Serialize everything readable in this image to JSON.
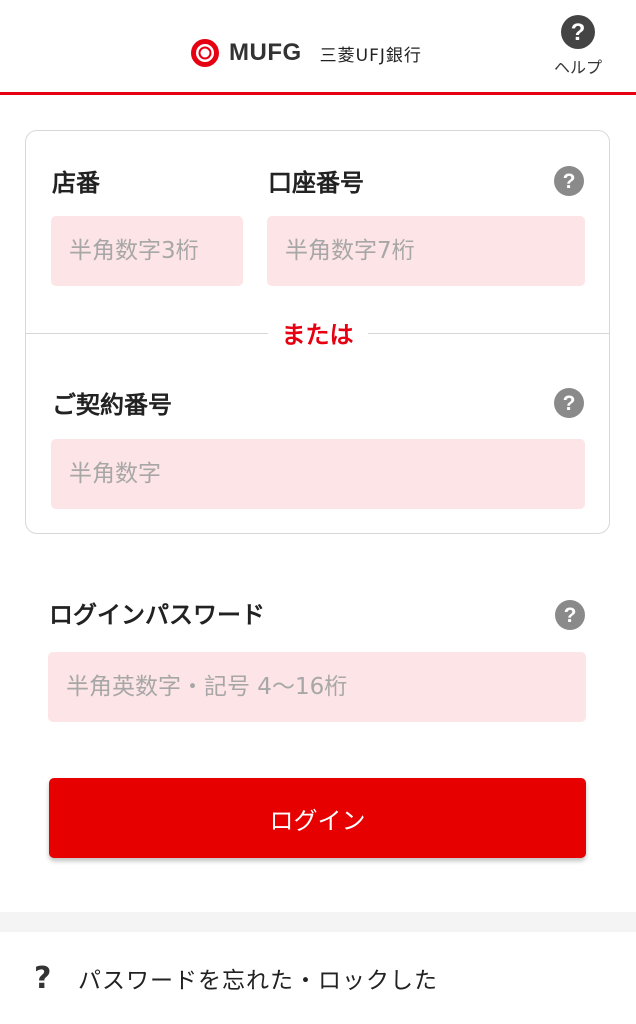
{
  "header": {
    "logo_word": "MUFG",
    "bank_name": "三菱UFJ銀行",
    "help_label": "ヘルプ",
    "brand_color": "#e60012"
  },
  "form": {
    "branch": {
      "label": "店番",
      "placeholder": "半角数字3桁"
    },
    "account": {
      "label": "口座番号",
      "placeholder": "半角数字7桁"
    },
    "or_text": "または",
    "contract": {
      "label": "ご契約番号",
      "placeholder": "半角数字"
    },
    "password": {
      "label": "ログインパスワード",
      "placeholder": "半角英数字・記号 4〜16桁"
    }
  },
  "login_button": {
    "label": "ログイン",
    "color": "#e60000"
  },
  "forgot": {
    "icon": "question-mark-icon",
    "label": "パスワードを忘れた・ロックした"
  },
  "icons": {
    "help": "help-circle-icon",
    "field_help": "question-circle-icon",
    "logo": "mufg-logo-icon"
  }
}
